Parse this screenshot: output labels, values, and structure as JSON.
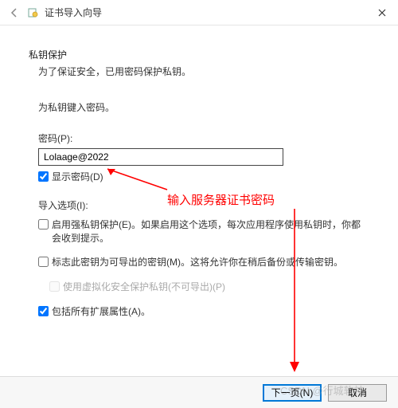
{
  "titlebar": {
    "title": "证书导入向导"
  },
  "section": {
    "title": "私钥保护",
    "desc": "为了保证安全，已用密码保护私钥。"
  },
  "prompt": "为私钥键入密码。",
  "password": {
    "label": "密码(P):",
    "value": "Lolaage@2022",
    "show_label": "显示密码(D)"
  },
  "options": {
    "label": "导入选项(I):",
    "opt1": "启用强私钥保护(E)。如果启用这个选项，每次应用程序使用私钥时，你都会收到提示。",
    "opt2": "标志此密钥为可导出的密钥(M)。这将允许你在稍后备份或传输密钥。",
    "opt3": "使用虚拟化安全保护私钥(不可导出)(P)",
    "opt4": "包括所有扩展属性(A)。"
  },
  "footer": {
    "next": "下一页(N)",
    "cancel": "取消"
  },
  "annotation": {
    "text": "输入服务器证书密码"
  },
  "watermark": "CSDN @行城软神"
}
